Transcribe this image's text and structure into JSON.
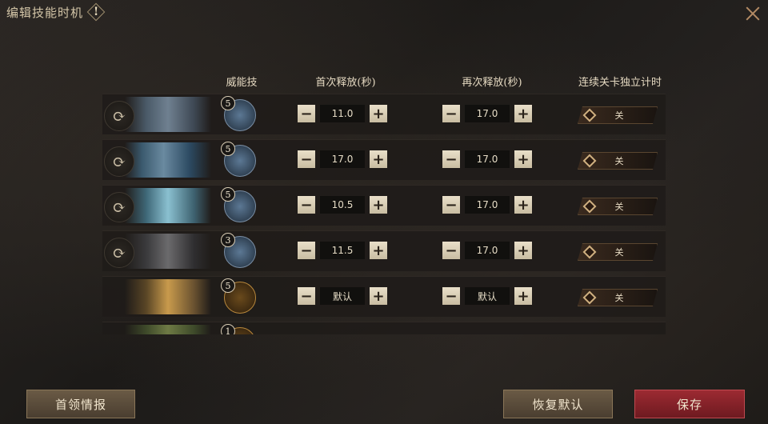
{
  "window": {
    "title": "编辑技能时机"
  },
  "headers": {
    "skill": "威能技",
    "first": "首次释放(秒)",
    "second": "再次释放(秒)",
    "independent": "连续关卡独立计时"
  },
  "rows": [
    {
      "level": "5",
      "first": "11.0",
      "second": "17.0",
      "toggle": "关",
      "has_reset": true
    },
    {
      "level": "5",
      "first": "17.0",
      "second": "17.0",
      "toggle": "关",
      "has_reset": true
    },
    {
      "level": "5",
      "first": "10.5",
      "second": "17.0",
      "toggle": "关",
      "has_reset": true
    },
    {
      "level": "3",
      "first": "11.5",
      "second": "17.0",
      "toggle": "关",
      "has_reset": true
    },
    {
      "level": "5",
      "first": "默认",
      "second": "默认",
      "toggle": "关",
      "has_reset": false
    },
    {
      "level": "1",
      "first": "",
      "second": "",
      "toggle": "",
      "has_reset": false
    }
  ],
  "buttons": {
    "boss_info": "首领情报",
    "restore_default": "恢复默认",
    "save": "保存"
  },
  "icons": {
    "info": "exclamation-icon",
    "close": "close-icon",
    "reset": "refresh-icon",
    "minus": "minus-icon",
    "plus": "plus-icon"
  },
  "colors": {
    "save": "#8a2028",
    "accent": "#c8b896"
  }
}
